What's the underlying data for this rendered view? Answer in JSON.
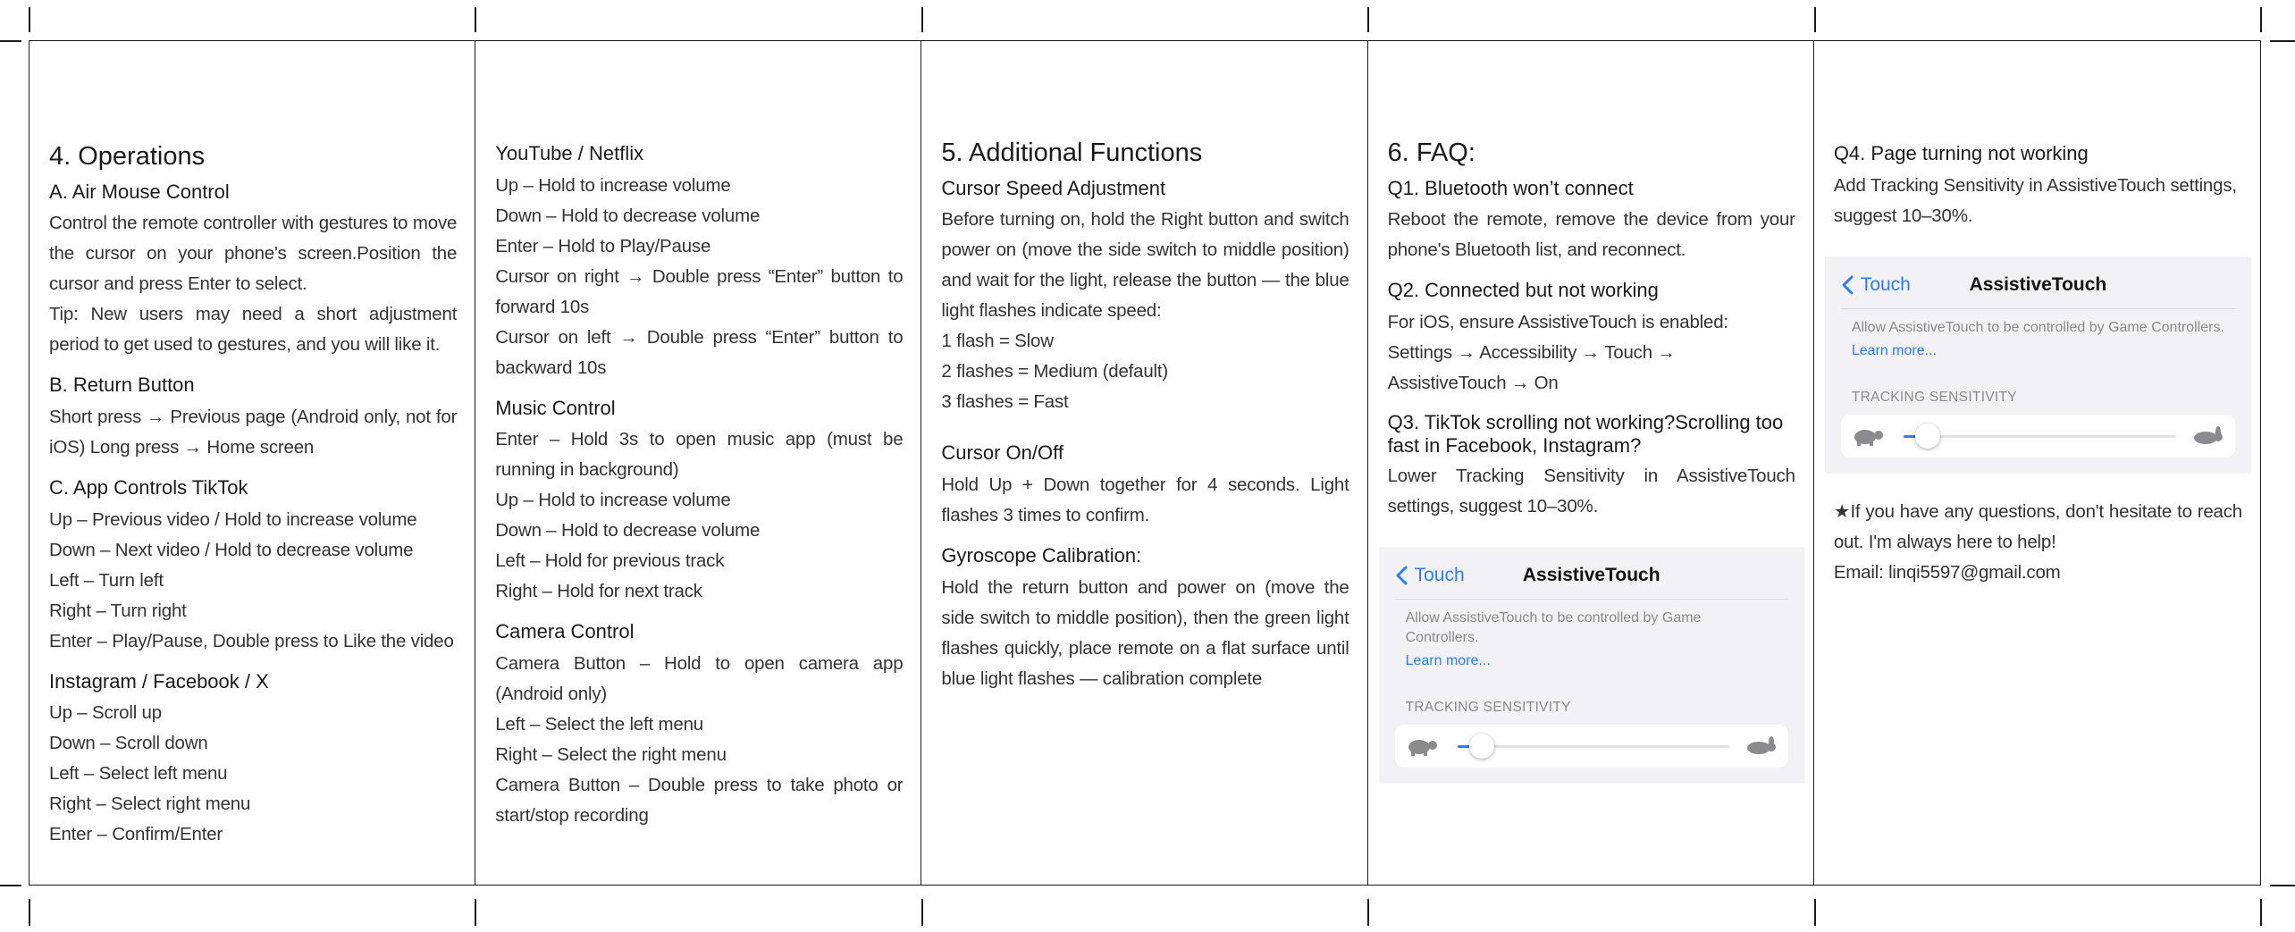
{
  "panel1": {
    "title": "4. Operations",
    "air_mouse": {
      "heading": "A. Air Mouse Control",
      "lines": [
        "Control the remote controller with gestures to move the cursor on your phone's screen.Position the cursor and press Enter to select.",
        "Tip: New users may need a short adjustment period to get used to gestures, and you will like it."
      ]
    },
    "return_button": {
      "heading": "B. Return Button",
      "lines": [
        "Short press → Previous page (Android only, not for iOS) Long press → Home screen"
      ]
    },
    "tiktok": {
      "heading": "C. App Controls TikTok",
      "lines": [
        "Up – Previous video / Hold to increase volume",
        "Down – Next video / Hold to decrease volume",
        "Left – Turn left",
        "Right – Turn right",
        "Enter – Play/Pause, Double press to Like the video"
      ]
    },
    "instagram": {
      "heading": "Instagram / Facebook / X",
      "lines": [
        "Up – Scroll up",
        "Down – Scroll down",
        "Left – Select left menu",
        "Right – Select right menu",
        "Enter – Confirm/Enter"
      ]
    }
  },
  "panel2": {
    "youtube": {
      "heading": "YouTube / Netflix",
      "lines": [
        "Up – Hold to increase volume",
        "Down – Hold to decrease volume",
        "Enter – Hold to Play/Pause",
        "Cursor on right → Double press “Enter” button to forward 10s",
        "Cursor on left → Double press “Enter” button to backward 10s"
      ]
    },
    "music": {
      "heading": "Music Control",
      "lines": [
        "Enter – Hold 3s to open music app (must be running in background)",
        "Up – Hold to increase volume",
        "Down – Hold to decrease volume",
        "Left – Hold for previous track",
        "Right – Hold for next track"
      ]
    },
    "camera": {
      "heading": "Camera Control",
      "lines": [
        "Camera Button – Hold to open camera app (Android only)",
        "Left – Select the left menu",
        "Right – Select the right menu",
        "Camera Button – Double press to take photo or start/stop recording"
      ]
    }
  },
  "panel3": {
    "title": "5. Additional Functions",
    "speed": {
      "heading": "Cursor Speed Adjustment",
      "lines": [
        "Before turning on, hold the Right button and switch power on (move the side switch to middle position) and wait for the light, release the button — the blue light flashes indicate speed:",
        "1 flash = Slow",
        "2 flashes = Medium (default)",
        "3 flashes = Fast"
      ]
    },
    "onoff": {
      "heading": "Cursor On/Off",
      "lines": [
        "Hold Up + Down together for 4 seconds. Light flashes 3 times to confirm."
      ]
    },
    "gyro": {
      "heading": "Gyroscope Calibration:",
      "lines": [
        "Hold the return button and power on (move the side switch to middle position), then the green light flashes quickly, place remote on a flat surface until blue light flashes — calibration complete"
      ]
    }
  },
  "panel4": {
    "title": "6. FAQ:",
    "q1": {
      "heading": "Q1. Bluetooth won’t connect",
      "lines": [
        "Reboot the remote, remove the device from your phone's Bluetooth list, and reconnect."
      ]
    },
    "q2": {
      "heading": "Q2. Connected but not working",
      "lines": [
        "For iOS, ensure AssistiveTouch is enabled: Settings → Accessibility → Touch → AssistiveTouch → On"
      ]
    },
    "q3": {
      "heading": "Q3. TikTok scrolling not working?Scrolling too fast in Facebook, Instagram?",
      "lines": [
        "Lower Tracking Sensitivity in AssistiveTouch settings, suggest 10–30%."
      ]
    },
    "ios": {
      "back": "Touch",
      "title": "AssistiveTouch",
      "note": "Allow AssistiveTouch to be controlled by Game Controllers.",
      "link": "Learn more...",
      "section": "TRACKING SENSITIVITY",
      "slider_level": 0.05
    }
  },
  "panel5": {
    "q4": {
      "heading": "Q4. Page turning not working",
      "lines": [
        "Add Tracking Sensitivity in AssistiveTouch settings, suggest 10–30%."
      ]
    },
    "ios": {
      "back": "Touch",
      "title": "AssistiveTouch",
      "note": "Allow AssistiveTouch to be controlled by Game Controllers.",
      "link": "Learn more...",
      "section": "TRACKING SENSITIVITY",
      "slider_level": 0.05
    },
    "contact": {
      "lines": [
        "★If you have any questions, don't hesitate to reach out. I'm always here to help!",
        "Email: linqi5597@gmail.com"
      ]
    }
  },
  "colors": {
    "ios_blue": "#2f7cf6",
    "ios_bg": "#f1f1f6",
    "text": "#333333"
  }
}
